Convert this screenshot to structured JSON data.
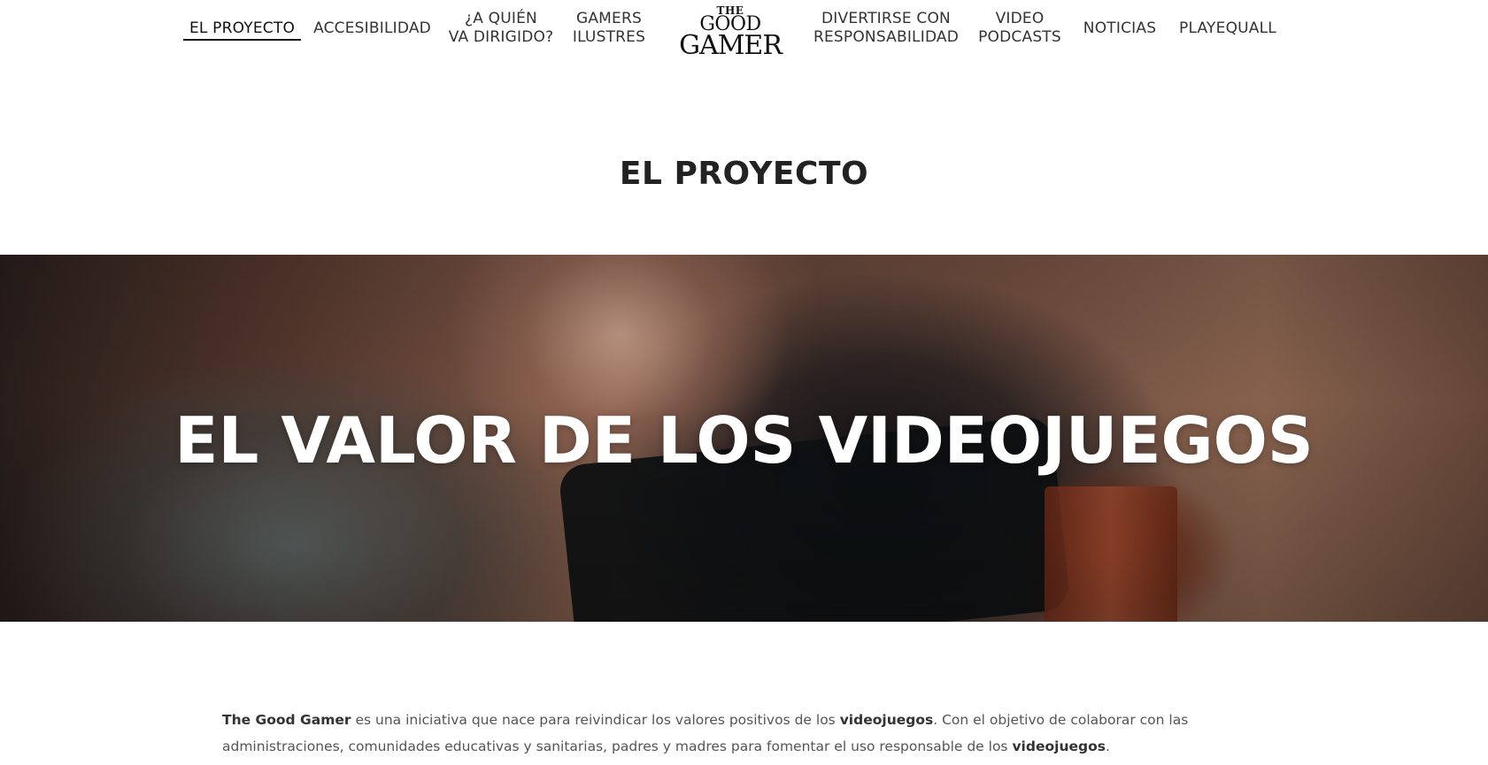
{
  "nav": {
    "items": [
      {
        "lines": [
          "EL PROYECTO"
        ],
        "active": true
      },
      {
        "lines": [
          "ACCESIBILIDAD"
        ],
        "active": false
      },
      {
        "lines": [
          "¿A QUIÉN",
          "VA DIRIGIDO?"
        ],
        "active": false
      },
      {
        "lines": [
          "GAMERS",
          "ILUSTRES"
        ],
        "active": false
      },
      {
        "lines": [
          "DIVERTIRSE CON",
          "RESPONSABILIDAD"
        ],
        "active": false
      },
      {
        "lines": [
          "VIDEO",
          "PODCASTS"
        ],
        "active": false
      },
      {
        "lines": [
          "NOTICIAS"
        ],
        "active": false
      },
      {
        "lines": [
          "PLAYEQUALL"
        ],
        "active": false
      }
    ],
    "logo": {
      "the": "THE",
      "good": "GOOD",
      "gamer": "GAMER"
    }
  },
  "page": {
    "title": "EL PROYECTO"
  },
  "hero": {
    "title": "EL VALOR DE LOS VIDEOJUEGOS"
  },
  "intro": {
    "p1_bold": "The Good Gamer",
    "p1_text": " es una iniciativa que nace para reivindicar los valores positivos de los ",
    "p1_bold2": "videojuegos",
    "p1_text2": ". Con el objetivo de colaborar con las administraciones, comunidades educativas y sanitarias, padres y madres para fomentar el uso responsable de los ",
    "p1_bold3": "videojuegos",
    "p1_text3": "."
  },
  "colors": {
    "text": "#2b2b2b",
    "nav_text": "#333333",
    "active_underline": "#111111",
    "hero_title": "#ffffff",
    "body_text": "#555555"
  }
}
